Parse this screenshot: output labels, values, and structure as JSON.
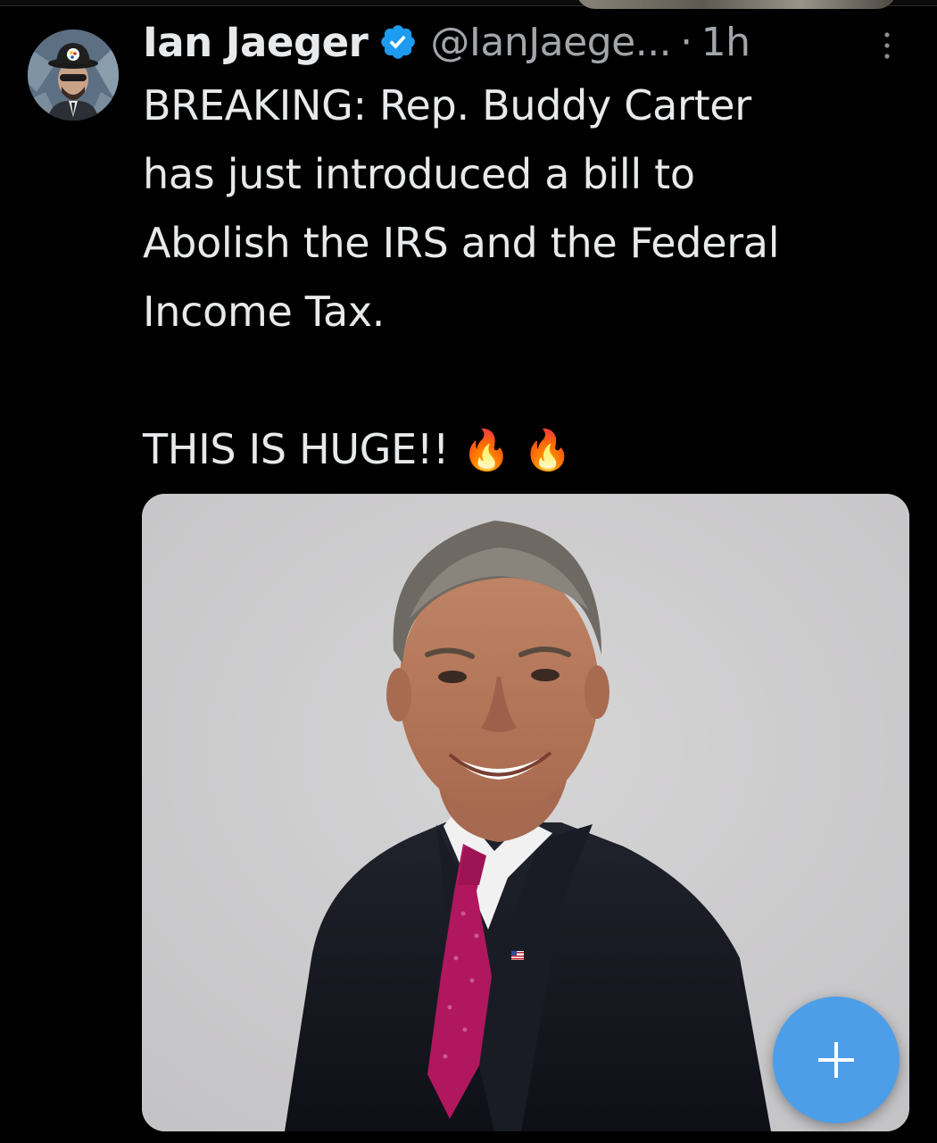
{
  "tweet": {
    "author_name": "Ian Jaeger",
    "handle": "@IanJaege...",
    "separator": "·",
    "time": "1h",
    "text_lines": [
      "BREAKING: Rep. Buddy Carter",
      "has just introduced a bill to",
      "Abolish the IRS and the Federal",
      "Income Tax."
    ],
    "emphasis": "THIS IS HUGE!!",
    "emojis": [
      "🔥",
      "🔥"
    ],
    "verified_color": "#1d9bf0"
  },
  "icons": {
    "more": "more-vertical-icon",
    "verified": "verified-badge-icon",
    "fab": "plus-icon"
  },
  "colors": {
    "background": "#000000",
    "text": "#e7e9ea",
    "secondary_text": "#a2a6aa",
    "fab": "#4c9ee8",
    "media_background": "#cdcccd"
  }
}
